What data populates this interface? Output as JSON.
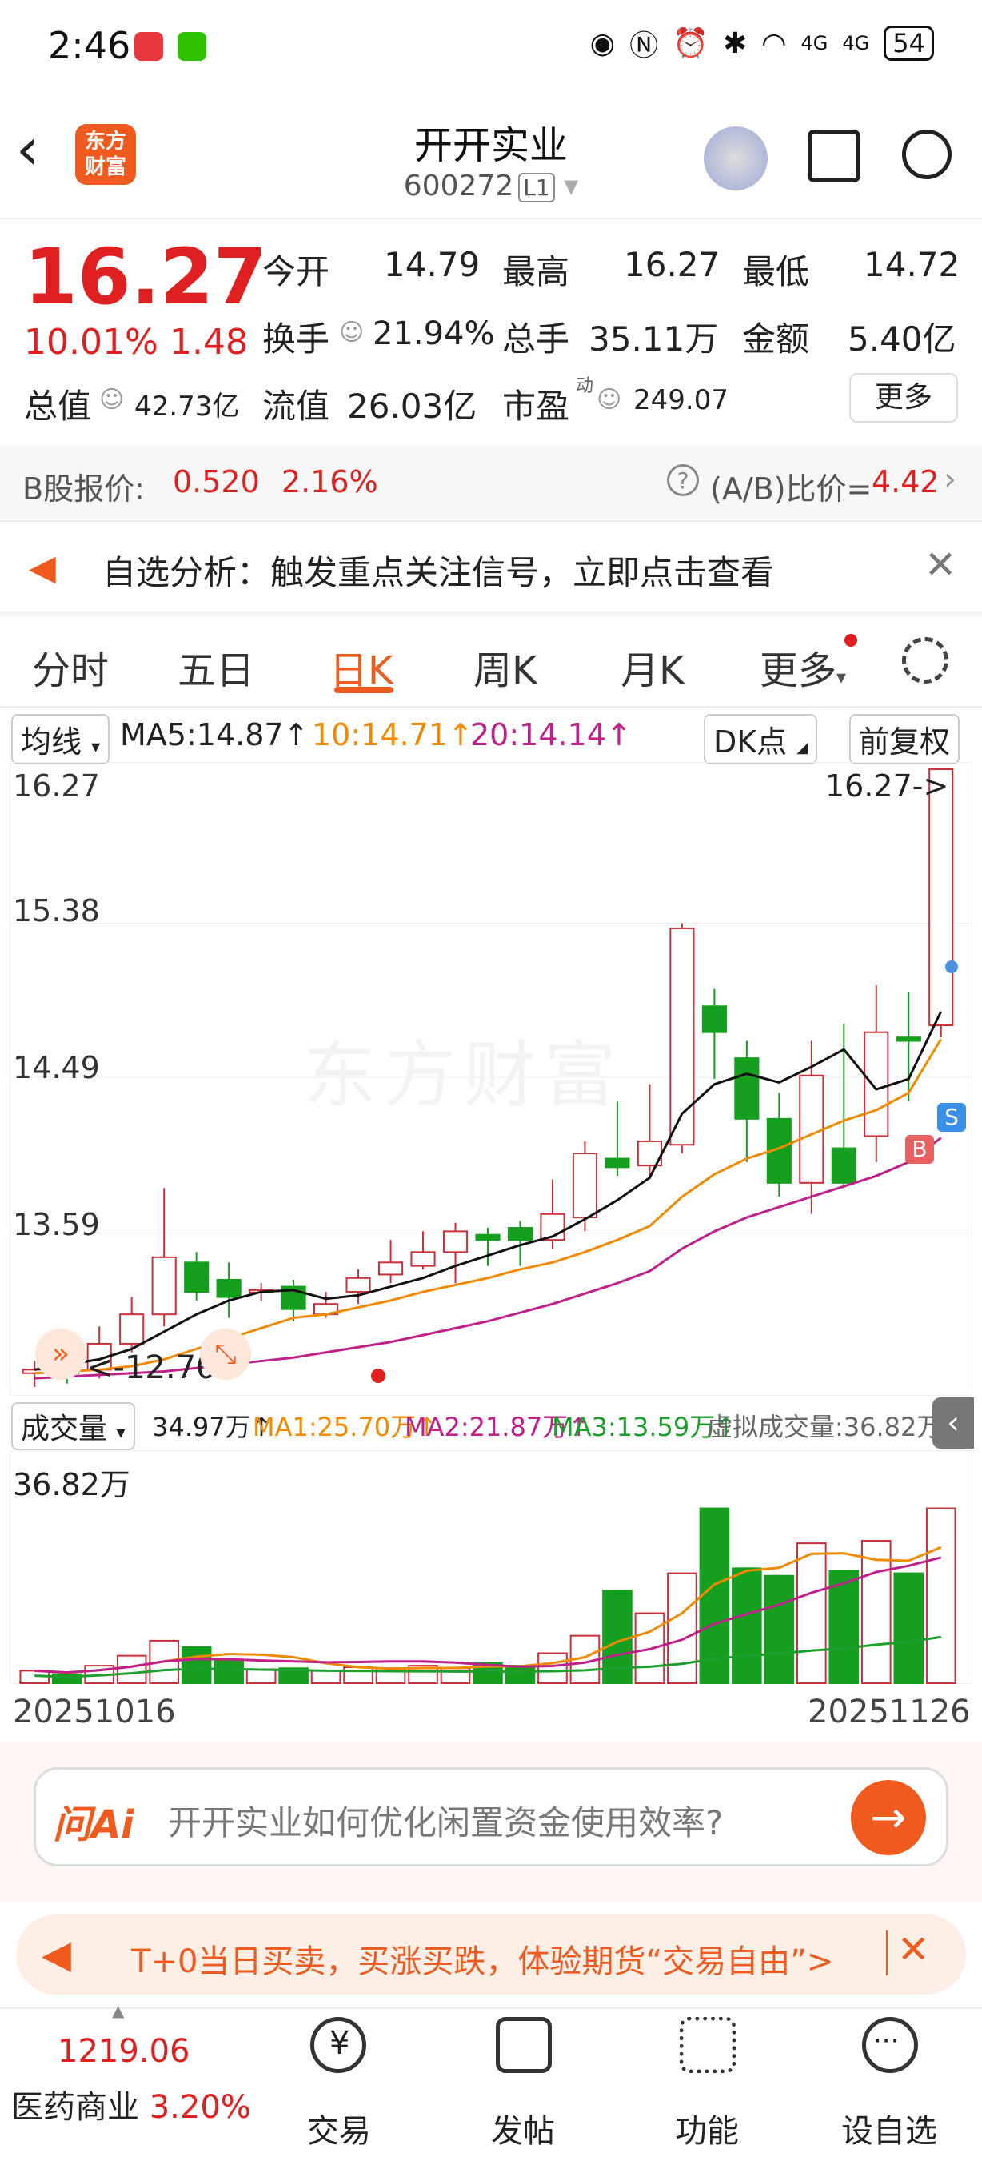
{
  "status": {
    "time": "2:46",
    "net1": "4G",
    "net2": "4G",
    "battery": "54"
  },
  "header": {
    "title": "开开实业",
    "code": "600272",
    "level": "L1",
    "logo_line1": "东方",
    "logo_line2": "财富"
  },
  "quote": {
    "price": "16.27",
    "change_pct": "10.01%",
    "change": "1.48",
    "open_label": "今开",
    "open": "14.79",
    "high_label": "最高",
    "high": "16.27",
    "low_label": "最低",
    "low": "14.72",
    "turnover_label": "换手",
    "turnover": "21.94%",
    "volume_label": "总手",
    "volume": "35.11万",
    "amount_label": "金额",
    "amount": "5.40亿",
    "mcap_label": "总值",
    "mcap": "42.73亿",
    "float_label": "流值",
    "float": "26.03亿",
    "pe_label": "市盈",
    "pe_sup": "动",
    "pe": "249.07",
    "more": "更多"
  },
  "bshare": {
    "label": "B股报价:",
    "price": "0.520",
    "pct": "2.16%",
    "ratio_label": "(A/B)比价=",
    "ratio": "4.42"
  },
  "notice": {
    "text": "自选分析：触发重点关注信号，立即点击查看"
  },
  "tabs": [
    "分时",
    "五日",
    "日K",
    "周K",
    "月K",
    "更多"
  ],
  "ma_bar": {
    "selector": "均线",
    "ma5": "MA5:14.87↑",
    "ma10": "10:14.71↑",
    "ma20": "20:14.14↑",
    "dk": "DK点",
    "fq": "前复权"
  },
  "kchart": {
    "y_labels": [
      "16.27",
      "15.38",
      "14.49",
      "13.59"
    ],
    "last": "16.27->",
    "low_mark": "12.70",
    "b_mark": "B",
    "s_mark": "S",
    "watermark": "东方财富"
  },
  "vol_bar": {
    "selector": "成交量",
    "v": "34.97万↑",
    "ma1": "MA1:25.70万↑",
    "ma2": "MA2:21.87万↑",
    "ma3": "MA3:13.59万↑",
    "virtual": "虚拟成交量:36.82万"
  },
  "vchart": {
    "top": "36.82万",
    "date_start": "20251016",
    "date_end": "20251126"
  },
  "chart_data": {
    "type": "candlestick",
    "x_range": [
      "20251016",
      "20251126"
    ],
    "ylim": [
      12.7,
      16.27
    ],
    "candles": [
      {
        "o": 12.78,
        "c": 12.8,
        "h": 12.85,
        "l": 12.7
      },
      {
        "o": 12.85,
        "c": 12.78,
        "h": 12.92,
        "l": 12.72
      },
      {
        "o": 12.8,
        "c": 12.95,
        "h": 13.05,
        "l": 12.75
      },
      {
        "o": 12.95,
        "c": 13.12,
        "h": 13.22,
        "l": 12.9
      },
      {
        "o": 13.12,
        "c": 13.45,
        "h": 13.85,
        "l": 13.05
      },
      {
        "o": 13.42,
        "c": 13.25,
        "h": 13.48,
        "l": 13.2
      },
      {
        "o": 13.32,
        "c": 13.22,
        "h": 13.42,
        "l": 13.1
      },
      {
        "o": 13.25,
        "c": 13.26,
        "h": 13.3,
        "l": 13.2
      },
      {
        "o": 13.28,
        "c": 13.15,
        "h": 13.32,
        "l": 13.08
      },
      {
        "o": 13.12,
        "c": 13.18,
        "h": 13.25,
        "l": 13.1
      },
      {
        "o": 13.25,
        "c": 13.33,
        "h": 13.38,
        "l": 13.18
      },
      {
        "o": 13.35,
        "c": 13.42,
        "h": 13.55,
        "l": 13.3
      },
      {
        "o": 13.4,
        "c": 13.48,
        "h": 13.6,
        "l": 13.38
      },
      {
        "o": 13.48,
        "c": 13.6,
        "h": 13.65,
        "l": 13.3
      },
      {
        "o": 13.58,
        "c": 13.55,
        "h": 13.62,
        "l": 13.4
      },
      {
        "o": 13.62,
        "c": 13.55,
        "h": 13.66,
        "l": 13.4
      },
      {
        "o": 13.55,
        "c": 13.7,
        "h": 13.9,
        "l": 13.5
      },
      {
        "o": 13.68,
        "c": 14.05,
        "h": 14.12,
        "l": 13.6
      },
      {
        "o": 14.02,
        "c": 13.97,
        "h": 14.35,
        "l": 13.92
      },
      {
        "o": 13.98,
        "c": 14.12,
        "h": 14.45,
        "l": 13.9
      },
      {
        "o": 14.1,
        "c": 15.35,
        "h": 15.38,
        "l": 14.05
      },
      {
        "o": 14.9,
        "c": 14.75,
        "h": 15.0,
        "l": 14.48
      },
      {
        "o": 14.6,
        "c": 14.25,
        "h": 14.7,
        "l": 14.0
      },
      {
        "o": 14.25,
        "c": 13.88,
        "h": 14.4,
        "l": 13.8
      },
      {
        "o": 13.88,
        "c": 14.5,
        "h": 14.7,
        "l": 13.7
      },
      {
        "o": 14.08,
        "c": 13.88,
        "h": 14.8,
        "l": 13.85
      },
      {
        "o": 14.15,
        "c": 14.75,
        "h": 15.02,
        "l": 14.0
      },
      {
        "o": 14.72,
        "c": 14.7,
        "h": 14.98,
        "l": 14.35
      },
      {
        "o": 14.79,
        "c": 16.27,
        "h": 16.27,
        "l": 14.72
      }
    ],
    "volumes": [
      2.5,
      1.8,
      3.5,
      5.5,
      8.5,
      7.2,
      4.5,
      2.8,
      3.0,
      2.5,
      3.2,
      3.0,
      3.5,
      3.0,
      4.0,
      3.5,
      6.0,
      9.5,
      18.5,
      14.0,
      22.0,
      34.97,
      23.0,
      21.5,
      28.0,
      22.5,
      28.5,
      22.0,
      34.97
    ],
    "ma5": [
      12.8,
      12.83,
      12.86,
      12.92,
      13.02,
      13.12,
      13.2,
      13.25,
      13.26,
      13.21,
      13.23,
      13.28,
      13.33,
      13.4,
      13.46,
      13.52,
      13.57,
      13.67,
      13.78,
      13.91,
      14.28,
      14.45,
      14.51,
      14.46,
      14.55,
      14.65,
      14.42,
      14.48,
      14.87
    ],
    "ma10": [
      12.78,
      12.79,
      12.8,
      12.82,
      12.86,
      12.92,
      12.98,
      13.04,
      13.1,
      13.12,
      13.16,
      13.2,
      13.25,
      13.29,
      13.33,
      13.38,
      13.42,
      13.48,
      13.55,
      13.63,
      13.8,
      13.93,
      14.02,
      14.08,
      14.16,
      14.24,
      14.3,
      14.4,
      14.71
    ],
    "ma20": [
      12.75,
      12.76,
      12.77,
      12.78,
      12.79,
      12.81,
      12.83,
      12.85,
      12.87,
      12.9,
      12.93,
      12.96,
      13.0,
      13.04,
      13.08,
      13.13,
      13.18,
      13.24,
      13.3,
      13.37,
      13.5,
      13.6,
      13.68,
      13.74,
      13.8,
      13.86,
      13.92,
      14.0,
      14.14
    ]
  }
}
